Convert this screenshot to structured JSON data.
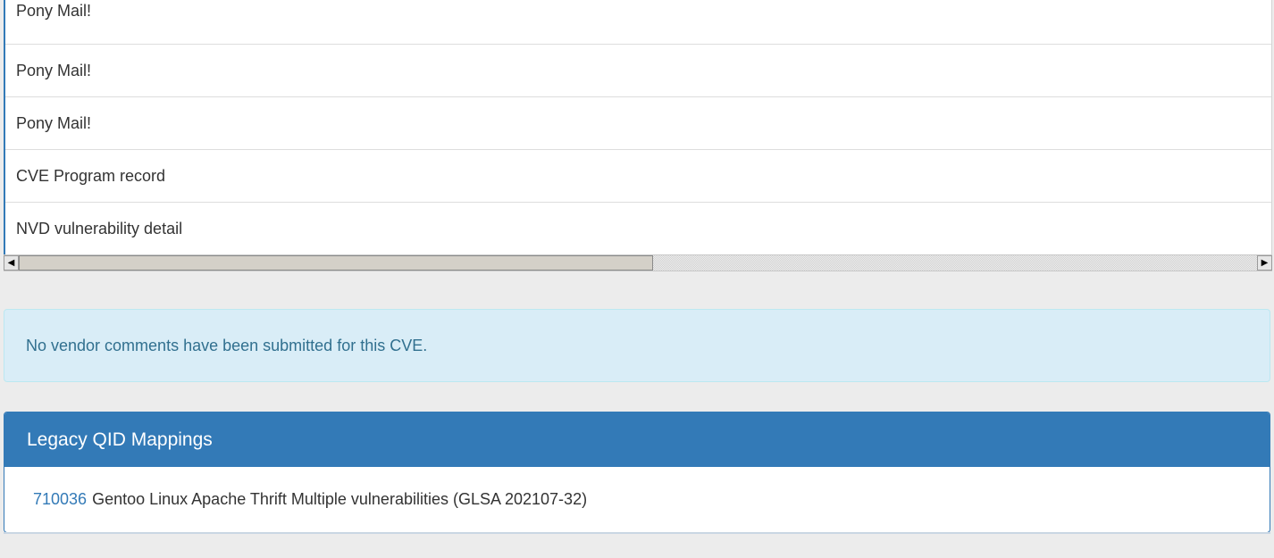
{
  "references": {
    "rows": [
      {
        "label": "Pony Mail!"
      },
      {
        "label": "Pony Mail!"
      },
      {
        "label": "Pony Mail!"
      },
      {
        "label": "CVE Program record"
      },
      {
        "label": "NVD vulnerability detail"
      }
    ],
    "scrollbar": {
      "left_arrow": "◀",
      "right_arrow": "▶"
    }
  },
  "vendor_comments": {
    "message": "No vendor comments have been submitted for this CVE."
  },
  "legacy_qid": {
    "heading": "Legacy QID Mappings",
    "entries": [
      {
        "qid": "710036",
        "title": "Gentoo Linux Apache Thrift Multiple vulnerabilities (GLSA 202107-32)"
      }
    ]
  },
  "colors": {
    "primary": "#337ab7",
    "info_bg": "#d9edf7",
    "info_text": "#31708f",
    "page_bg": "#ececec"
  }
}
